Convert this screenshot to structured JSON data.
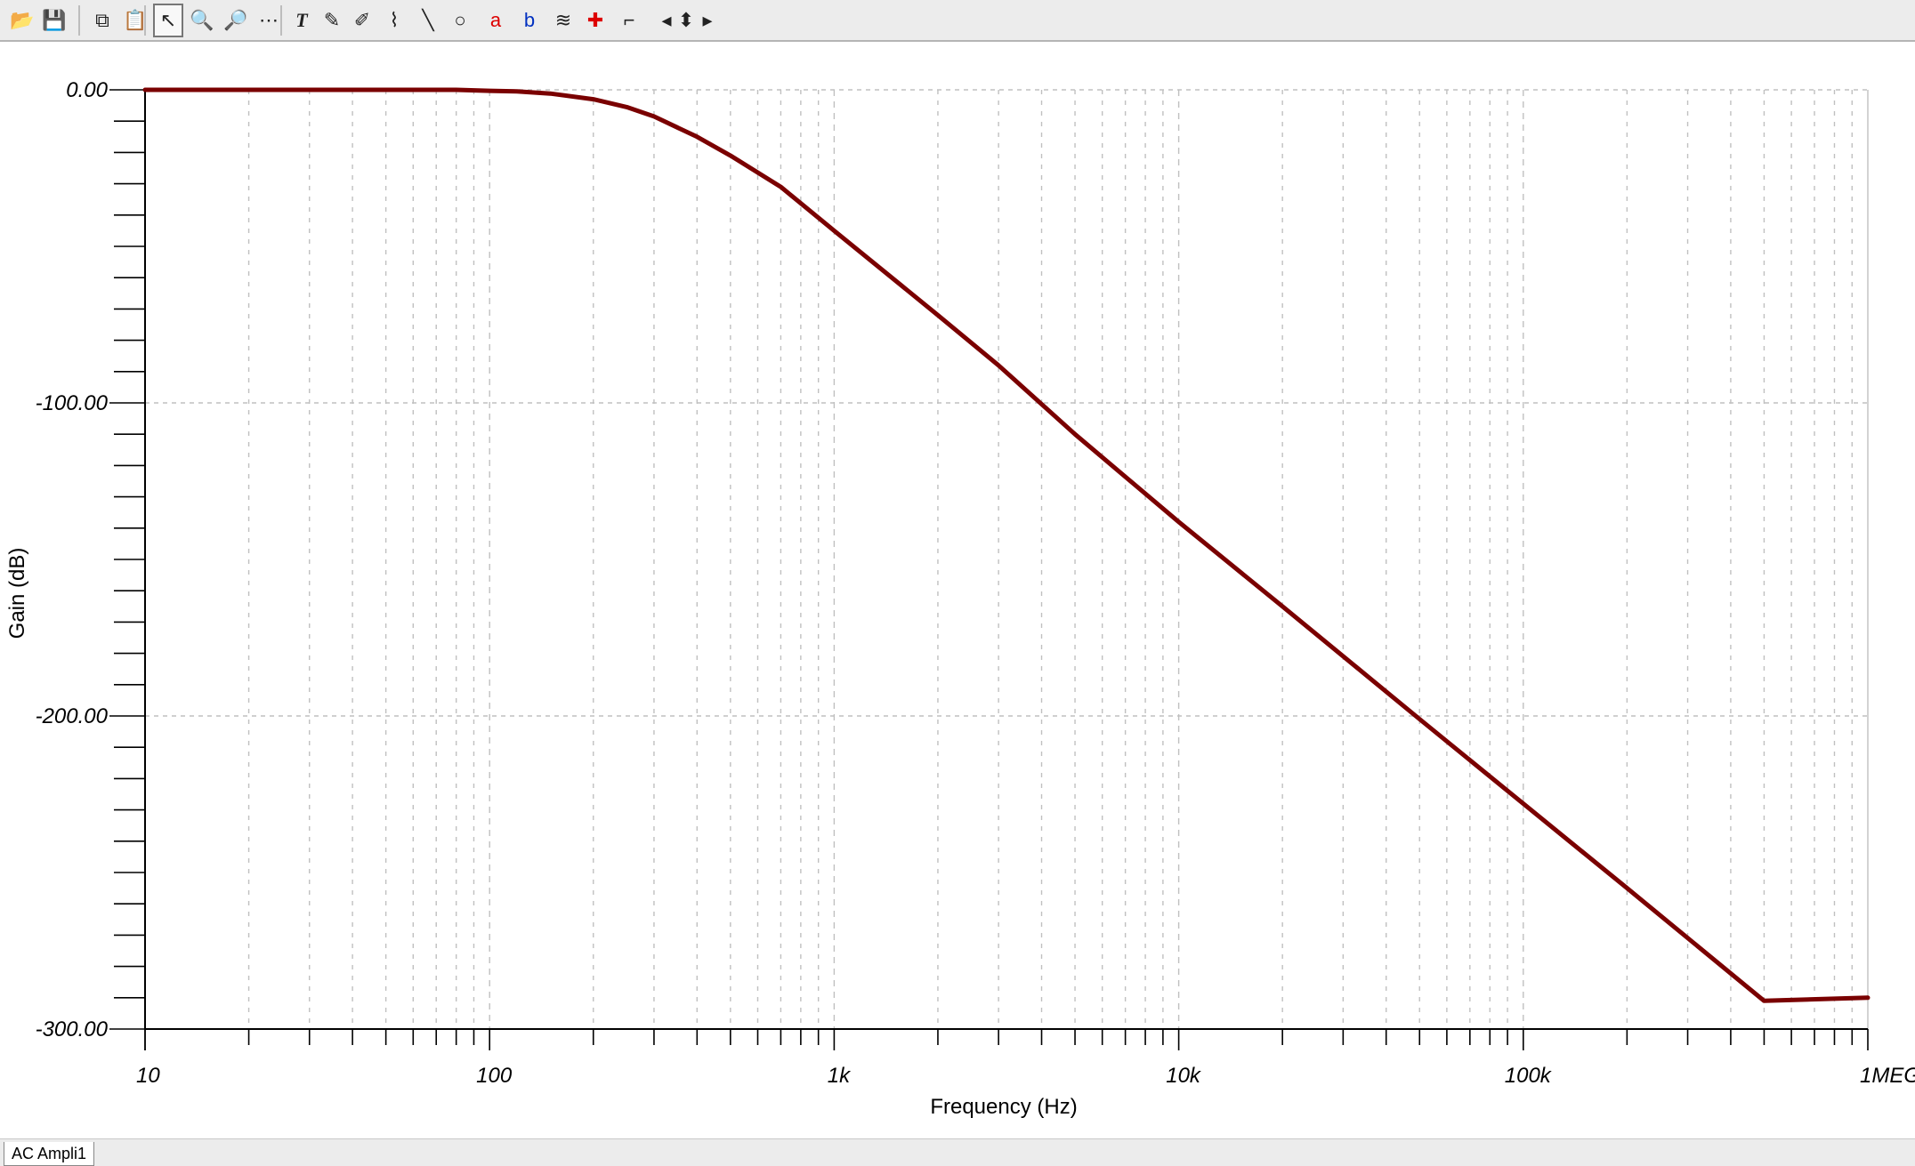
{
  "toolbar": {
    "buttons": [
      {
        "name": "open-folder-icon",
        "glyph": "📂"
      },
      {
        "name": "save-icon",
        "glyph": "💾"
      },
      {
        "name": "copy-icon",
        "glyph": "⧉"
      },
      {
        "name": "paste-icon",
        "glyph": "📋"
      },
      {
        "name": "select-arrow-icon",
        "glyph": "↖",
        "active": true
      },
      {
        "name": "zoom-in-icon",
        "glyph": "🔍"
      },
      {
        "name": "zoom-100-icon",
        "glyph": "🔎"
      },
      {
        "name": "grid-icon",
        "glyph": "⋯"
      },
      {
        "name": "text-tool-icon",
        "glyph": "T"
      },
      {
        "name": "pen-tool-icon",
        "glyph": "✎"
      },
      {
        "name": "pen-curve-icon",
        "glyph": "✐"
      },
      {
        "name": "axis-label-icon",
        "glyph": "⌇"
      },
      {
        "name": "line-tool-icon",
        "glyph": "╲"
      },
      {
        "name": "ellipse-tool-icon",
        "glyph": "○"
      },
      {
        "name": "cursor-a-icon",
        "glyph": "a"
      },
      {
        "name": "cursor-b-icon",
        "glyph": "b"
      },
      {
        "name": "add-curve-icon",
        "glyph": "≋"
      },
      {
        "name": "probe-icon",
        "glyph": "✚"
      },
      {
        "name": "step-icon",
        "glyph": "⌐"
      },
      {
        "name": "nav-left-icon",
        "glyph": "◂"
      },
      {
        "name": "nav-updown-icon",
        "glyph": "⬍"
      },
      {
        "name": "nav-right-icon",
        "glyph": "▸"
      }
    ]
  },
  "statusbar": {
    "tab_label": "AC Ampli1"
  },
  "colors": {
    "curve": "#7a0000",
    "grid": "#c0c0c0",
    "axis": "#000000"
  },
  "chart_data": {
    "type": "line",
    "xlabel": "Frequency (Hz)",
    "ylabel": "Gain (dB)",
    "x_scale": "log",
    "xlim": [
      10,
      1000000
    ],
    "ylim": [
      -300,
      0
    ],
    "x_tick_values": [
      10,
      100,
      1000,
      10000,
      100000,
      1000000
    ],
    "x_tick_labels": [
      "10",
      "100",
      "1k",
      "10k",
      "100k",
      "1MEG"
    ],
    "y_tick_values": [
      0,
      -100,
      -200,
      -300
    ],
    "y_tick_labels": [
      "0.00",
      "-100.00",
      "-200.00",
      "-300.00"
    ],
    "grid": true,
    "series": [
      {
        "name": "",
        "x": [
          10,
          20,
          50,
          80,
          100,
          120,
          150,
          200,
          250,
          300,
          400,
          500,
          700,
          1000,
          2000,
          3000,
          5000,
          10000,
          20000,
          50000,
          100000,
          200000,
          500000,
          1000000
        ],
        "y": [
          0,
          0,
          0,
          0,
          -0.3,
          -0.5,
          -1.2,
          -3,
          -5.5,
          -8.5,
          -15,
          -21,
          -31,
          -45,
          -72,
          -88,
          -110,
          -138,
          -165,
          -201,
          -228,
          -255,
          -291,
          -290
        ]
      }
    ]
  }
}
